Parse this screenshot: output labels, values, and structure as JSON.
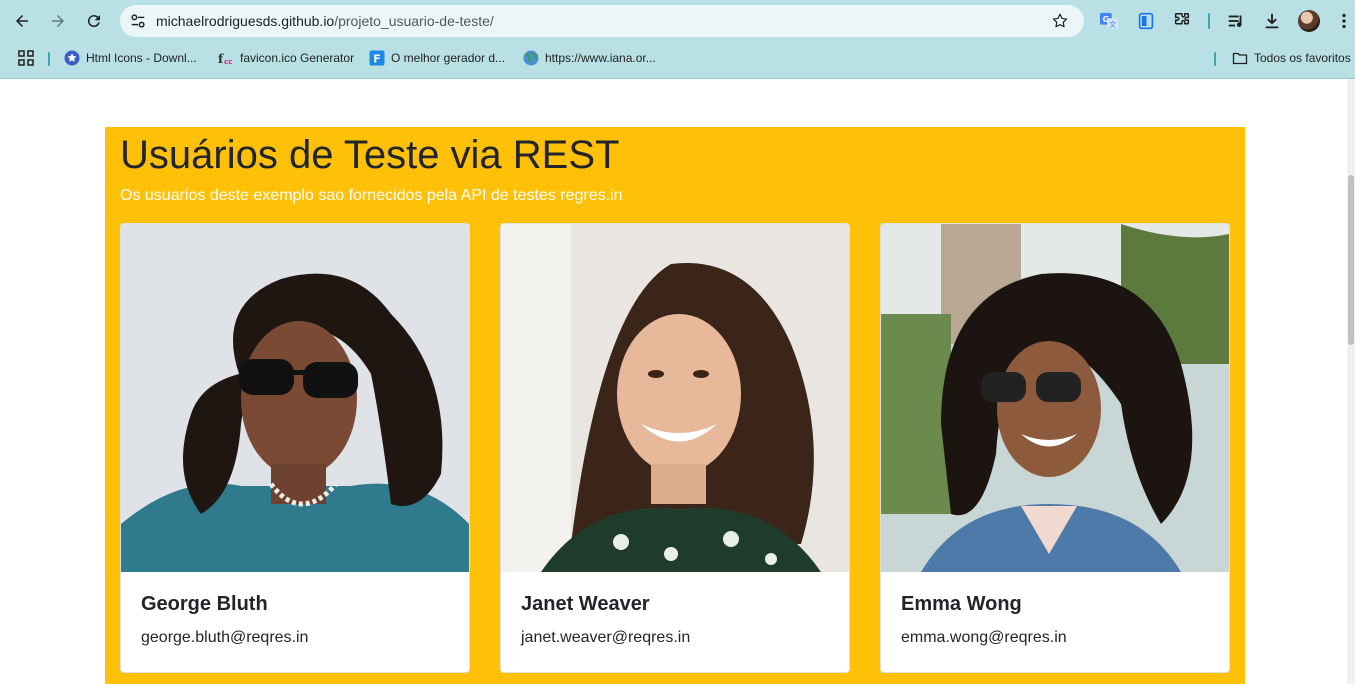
{
  "browser": {
    "url_host": "michaelrodriguesds.github.io",
    "url_path": "/projeto_usuario-de-teste/",
    "bookmarks": [
      {
        "label": "Html Icons - Downl...",
        "icon": "star-circle-icon"
      },
      {
        "label": "favicon.ico Generator",
        "icon": "favicon-generator-icon"
      },
      {
        "label": "O melhor gerador d...",
        "icon": "f-square-icon"
      },
      {
        "label": "https://www.iana.or...",
        "icon": "globe-icon"
      }
    ],
    "all_bookmarks_label": "Todos os favoritos",
    "colors": {
      "chrome": "#b9e1e5",
      "omnibox": "#eaf6f7"
    }
  },
  "page": {
    "title": "Usuários de Teste via REST",
    "subtitle": "Os usuarios deste exemplo sao fornecidos pela API de testes regres.in",
    "colors": {
      "jumbotron": "#ffc107",
      "text": "#212529",
      "subtitle": "#ffffff"
    },
    "users": [
      {
        "name": "George Bluth",
        "email": "george.bluth@reqres.in",
        "photo": "man-with-sunglasses-portrait"
      },
      {
        "name": "Janet Weaver",
        "email": "janet.weaver@reqres.in",
        "photo": "smiling-woman-portrait"
      },
      {
        "name": "Emma Wong",
        "email": "emma.wong@reqres.in",
        "photo": "woman-with-curly-hair-portrait"
      }
    ]
  }
}
